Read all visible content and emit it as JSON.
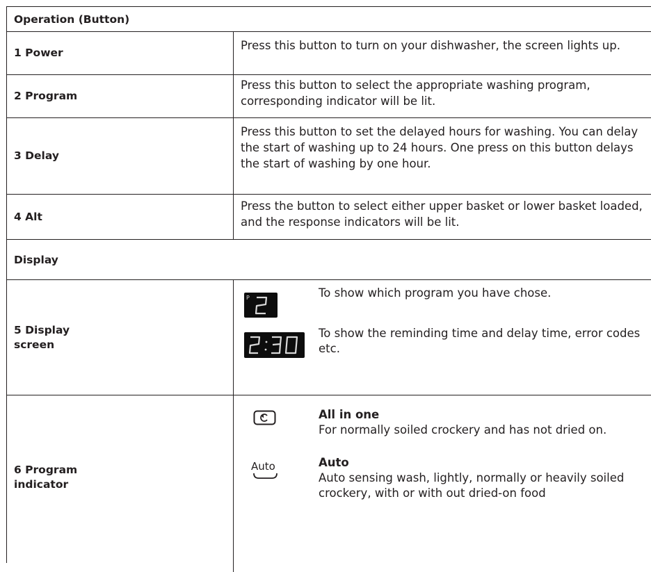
{
  "sections": {
    "operation": "Operation (Button)",
    "display": "Display"
  },
  "rows": [
    {
      "label": "1 Power",
      "desc": "Press this button to turn on your dishwasher, the screen lights up."
    },
    {
      "label": "2 Program",
      "desc": "Press this button to select the appropriate washing program, corresponding indicator will be lit."
    },
    {
      "label": "3 Delay",
      "desc": "Press this button to set the delayed hours for washing. You can delay the start of washing up to 24 hours. One press on this button delays the start of washing by one hour."
    },
    {
      "label": "4 Alt",
      "desc": "Press the button to select either upper basket or lower basket loaded, and the response indicators will be lit."
    }
  ],
  "display_screen": {
    "label": "5 Display\nscreen",
    "program_digit": {
      "prefix": "P",
      "digit": "2",
      "text": "To show which program you have chose."
    },
    "time_digits": {
      "value": "2:30",
      "text": "To show the reminding time and delay time, error codes etc."
    }
  },
  "program_indicator": {
    "label": "6 Program\nindicator",
    "items": [
      {
        "icon": "all-in-one-icon",
        "title": "All in one",
        "text": "For normally soiled crockery and has not dried on."
      },
      {
        "icon": "auto-icon",
        "icon_text": "Auto",
        "title": "Auto",
        "text": "Auto sensing wash, lightly, normally or heavily soiled crockery, with or with out dried-on food"
      }
    ]
  }
}
